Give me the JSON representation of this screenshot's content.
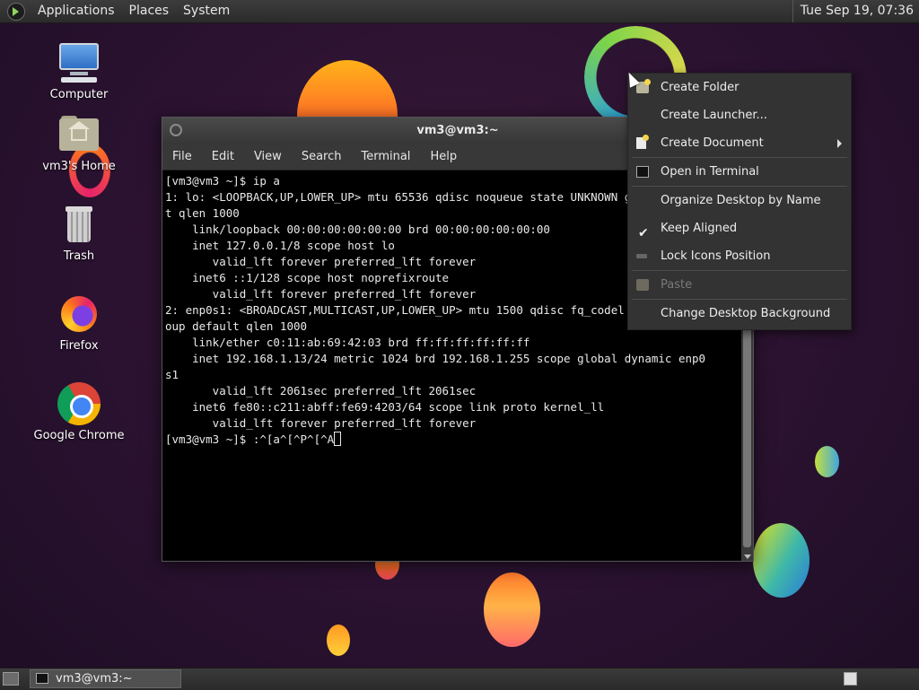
{
  "top_panel": {
    "menus": [
      "Applications",
      "Places",
      "System"
    ],
    "clock": "Tue Sep 19, 07:36"
  },
  "desktop": {
    "icons": [
      {
        "label": "Computer",
        "icon": "computer-icon"
      },
      {
        "label": "vm3's Home",
        "icon": "home-folder-icon"
      },
      {
        "label": "Trash",
        "icon": "trash-icon"
      },
      {
        "label": "Firefox",
        "icon": "firefox-icon"
      },
      {
        "label": "Google Chrome",
        "icon": "chrome-icon"
      }
    ]
  },
  "terminal": {
    "title": "vm3@vm3:~",
    "menu": [
      "File",
      "Edit",
      "View",
      "Search",
      "Terminal",
      "Help"
    ],
    "lines": [
      "[vm3@vm3 ~]$ ip a",
      "1: lo: <LOOPBACK,UP,LOWER_UP> mtu 65536 qdisc noqueue state UNKNOWN group defaul",
      "t qlen 1000",
      "    link/loopback 00:00:00:00:00:00 brd 00:00:00:00:00:00",
      "    inet 127.0.0.1/8 scope host lo",
      "       valid_lft forever preferred_lft forever",
      "    inet6 ::1/128 scope host noprefixroute",
      "       valid_lft forever preferred_lft forever",
      "2: enp0s1: <BROADCAST,MULTICAST,UP,LOWER_UP> mtu 1500 qdisc fq_codel state UP gr",
      "oup default qlen 1000",
      "    link/ether c0:11:ab:69:42:03 brd ff:ff:ff:ff:ff:ff",
      "    inet 192.168.1.13/24 metric 1024 brd 192.168.1.255 scope global dynamic enp0",
      "s1",
      "       valid_lft 2061sec preferred_lft 2061sec",
      "    inet6 fe80::c211:abff:fe69:4203/64 scope link proto kernel_ll",
      "       valid_lft forever preferred_lft forever"
    ],
    "prompt_line": "[vm3@vm3 ~]$ :^[a^[^P^[^A"
  },
  "context_menu": {
    "items": [
      {
        "label": "Create Folder",
        "icon": "folder-icon",
        "enabled": true
      },
      {
        "label": "Create Launcher...",
        "icon": "",
        "enabled": true
      },
      {
        "label": "Create Document",
        "icon": "document-icon",
        "enabled": true,
        "submenu": true
      },
      {
        "label": "Open in Terminal",
        "icon": "terminal-icon",
        "enabled": true
      },
      {
        "label": "Organize Desktop by Name",
        "icon": "",
        "enabled": true
      },
      {
        "label": "Keep Aligned",
        "icon": "check-icon",
        "enabled": true,
        "checked": true
      },
      {
        "label": "Lock Icons Position",
        "icon": "lock-icon",
        "enabled": true
      },
      {
        "label": "Paste",
        "icon": "paste-icon",
        "enabled": false
      },
      {
        "label": "Change Desktop Background",
        "icon": "",
        "enabled": true
      }
    ]
  },
  "taskbar": {
    "window_button": "vm3@vm3:~"
  }
}
